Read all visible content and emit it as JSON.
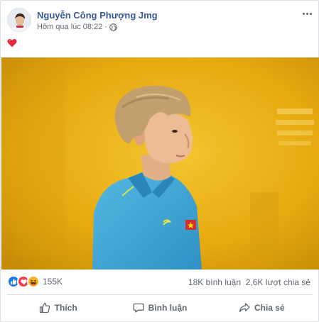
{
  "post": {
    "author": "Nguyễn Công Phượng Jmg",
    "timestamp": "Hôm qua lúc 08:22",
    "separator": "·",
    "privacy_icon": "globe-icon",
    "menu_icon": "more-options-icon",
    "caption_icon": "red-heart-emoji",
    "photo_subject": "photo"
  },
  "stats": {
    "reactions": [
      "like",
      "love",
      "haha"
    ],
    "reaction_count": "155K",
    "comments": "18K bình luận",
    "shares": "2,6K lượt chia sẻ"
  },
  "actions": {
    "like": "Thích",
    "comment": "Bình luận",
    "share": "Chia sẻ"
  },
  "colors": {
    "author_link": "#385898",
    "meta_text": "#606770",
    "like_blue": "#1877f2",
    "love_red": "#f33e58",
    "haha_yellow": "#f7b125",
    "photo_bg": "#e9ad16",
    "jersey": "#3ea9d8"
  }
}
